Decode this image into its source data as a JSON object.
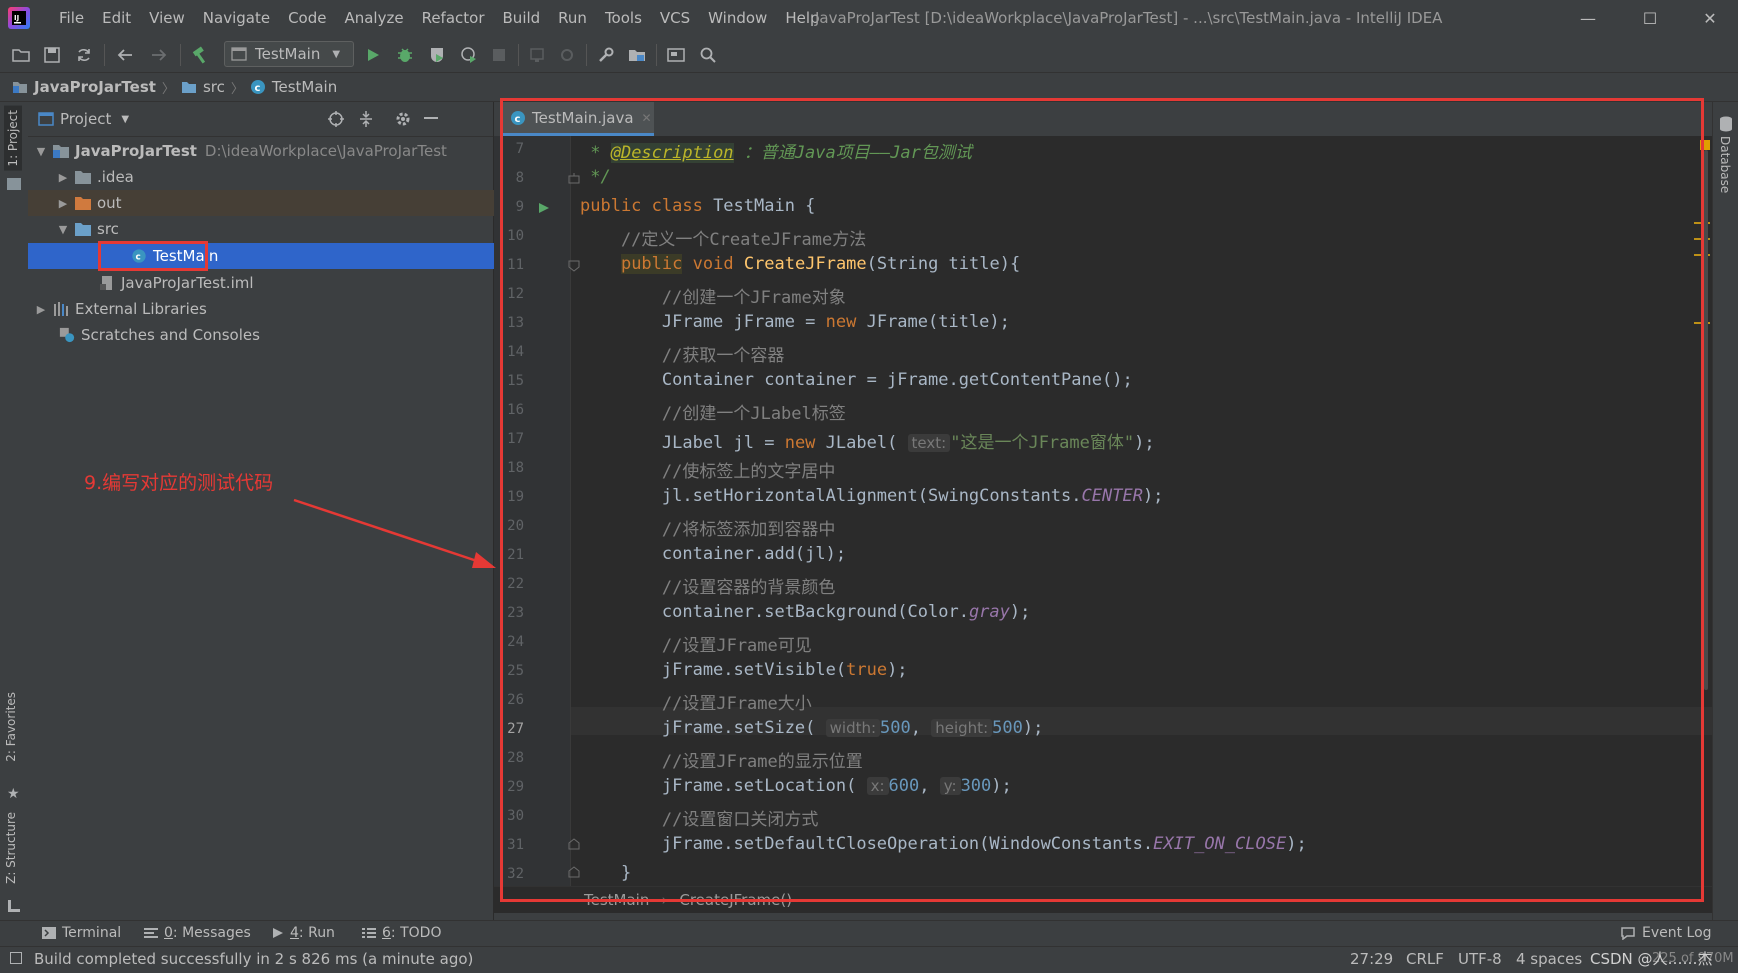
{
  "window": {
    "title": "JavaProJarTest [D:\\ideaWorkplace\\JavaProJarTest] - ...\\src\\TestMain.java - IntelliJ IDEA",
    "menu": [
      "File",
      "Edit",
      "View",
      "Navigate",
      "Code",
      "Analyze",
      "Refactor",
      "Build",
      "Run",
      "Tools",
      "VCS",
      "Window",
      "Help"
    ],
    "controls": {
      "minimize": "—",
      "maximize": "☐",
      "close": "✕"
    }
  },
  "toolbar": {
    "run_config": "TestMain"
  },
  "navbar": {
    "crumbs": [
      "JavaProJarTest",
      "src",
      "TestMain"
    ]
  },
  "left_stripe": {
    "project": "1: Project",
    "favorites": "2: Favorites",
    "structure": "Z: Structure"
  },
  "project": {
    "title": "Project",
    "tree": [
      {
        "label": "JavaProJarTest",
        "path": "D:\\ideaWorkplace\\JavaProJarTest"
      },
      {
        "label": ".idea"
      },
      {
        "label": "out"
      },
      {
        "label": "src"
      },
      {
        "label": "TestMain"
      },
      {
        "label": "JavaProJarTest.iml"
      },
      {
        "label": "External Libraries"
      },
      {
        "label": "Scratches and Consoles"
      }
    ]
  },
  "editor": {
    "tab": "TestMain.java",
    "line_numbers": [
      "7",
      "8",
      "9",
      "10",
      "11",
      "12",
      "13",
      "14",
      "15",
      "16",
      "17",
      "18",
      "19",
      "20",
      "21",
      "22",
      "23",
      "24",
      "25",
      "26",
      "27",
      "28",
      "29",
      "30",
      "31",
      "32"
    ],
    "current_line": "27",
    "code": {
      "l7_doc_star": " * ",
      "l7_annotation": "@Description",
      "l7_text": " ：普通Java项目——Jar包测试",
      "l8": " */",
      "l9_kw": "public class",
      "l9_rest": " TestMain {",
      "l10": "    //定义一个CreateJFrame方法",
      "l11_kw1": "public",
      "l11_kw2": "void",
      "l11_fn": "CreateJFrame",
      "l11_rest": "(String title){",
      "l12": "        //创建一个JFrame对象",
      "l13_a": "        JFrame jFrame = ",
      "l13_kw": "new",
      "l13_b": " JFrame(title);",
      "l14": "        //获取一个容器",
      "l15": "        Container container = jFrame.getContentPane();",
      "l16": "        //创建一个JLabel标签",
      "l17_a": "        JLabel jl = ",
      "l17_kw": "new",
      "l17_b": " JLabel( ",
      "l17_hint": "text:",
      "l17_str": "\"这是一个JFrame窗体\"",
      "l17_c": ");",
      "l18": "        //使标签上的文字居中",
      "l19_a": "        jl.setHorizontalAlignment(SwingConstants.",
      "l19_const": "CENTER",
      "l19_b": ");",
      "l20": "        //将标签添加到容器中",
      "l21": "        container.add(jl);",
      "l22": "        //设置容器的背景颜色",
      "l23_a": "        container.setBackground(Color.",
      "l23_const": "gray",
      "l23_b": ");",
      "l24": "        //设置JFrame可见",
      "l25_a": "        jFrame.setVisible(",
      "l25_kw": "true",
      "l25_b": ");",
      "l26": "        //设置JFrame大小",
      "l27_a": "        jFrame.setSize( ",
      "l27_hint1": "width:",
      "l27_num1": "500",
      "l27_hint2": "height:",
      "l27_num2": "500",
      "l27_b": ");",
      "l28": "        //设置JFrame的显示位置",
      "l29_a": "        jFrame.setLocation( ",
      "l29_hint1": "x:",
      "l29_num1": "600",
      "l29_hint2": "y:",
      "l29_num2": "300",
      "l29_b": ");",
      "l30": "        //设置窗口关闭方式",
      "l31_a": "        jFrame.setDefaultCloseOperation(WindowConstants.",
      "l31_const": "EXIT_ON_CLOSE",
      "l31_b": ");",
      "l32": "    }"
    },
    "breadcrumb": [
      "TestMain",
      "CreateJFrame()"
    ]
  },
  "right_stripe": {
    "database": "Database"
  },
  "annotation": {
    "text": "9.编写对应的测试代码",
    "color": "#e53935"
  },
  "tool_tabs": [
    {
      "key": "",
      "label": "Terminal"
    },
    {
      "key": "0",
      "label": ": Messages"
    },
    {
      "key": "4",
      "label": ": Run"
    },
    {
      "key": "6",
      "label": ": TODO"
    }
  ],
  "event_log": "Event Log",
  "status": {
    "message": "Build completed successfully in 2 s 826 ms (a minute ago)",
    "position": "27:29",
    "line_sep": "CRLF",
    "encoding": "UTF-8",
    "indent": "4 spaces",
    "memory": "225 of 970M",
    "watermark": "CSDN @人……杰"
  },
  "colors": {
    "accent": "#4a88c7",
    "selection": "#2f65ca",
    "annotation_red": "#e53935"
  }
}
